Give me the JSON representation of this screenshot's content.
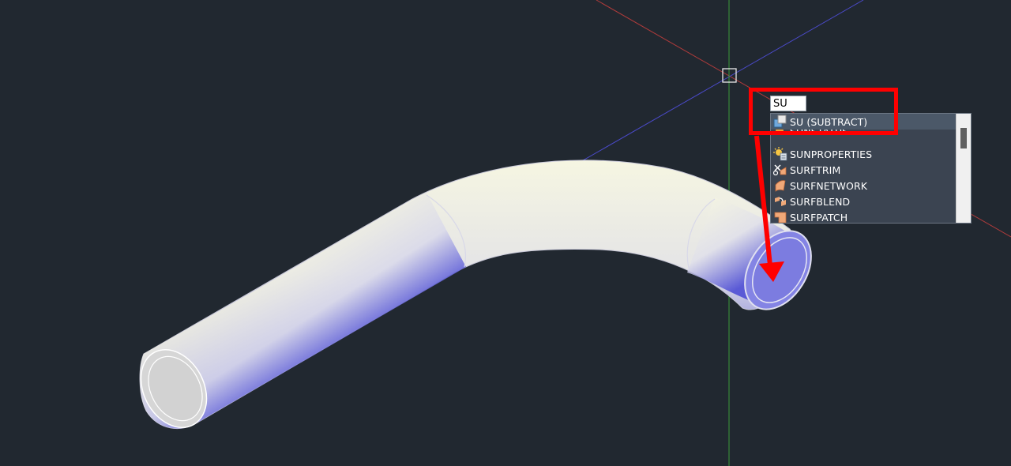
{
  "command_line": {
    "typed_text": "SU"
  },
  "autocomplete": {
    "items": [
      {
        "label": "SU (SUBTRACT)",
        "icon": "subtract-icon",
        "selected": true
      },
      {
        "label": "SUNSTATUS",
        "icon": "sun-status-icon"
      },
      {
        "label": "SUNPROPERTIES",
        "icon": "sun-properties-icon"
      },
      {
        "label": "SURFTRIM",
        "icon": "surface-trim-icon"
      },
      {
        "label": "SURFNETWORK",
        "icon": "surface-network-icon"
      },
      {
        "label": "SURFBLEND",
        "icon": "surface-blend-icon"
      },
      {
        "label": "SURFPATCH",
        "icon": "surface-patch-icon"
      }
    ]
  },
  "colors": {
    "background": "#212830",
    "annotation": "#ff0000",
    "pipe_light": "#f4f4dc",
    "pipe_shadow": "#3b3bd0",
    "pipe_end_cap": "#d8d8d8",
    "selected_face": "#8a8ae8",
    "axis_x": "#c04040",
    "axis_y": "#4040c0",
    "axis_z": "#3a9a3a"
  }
}
